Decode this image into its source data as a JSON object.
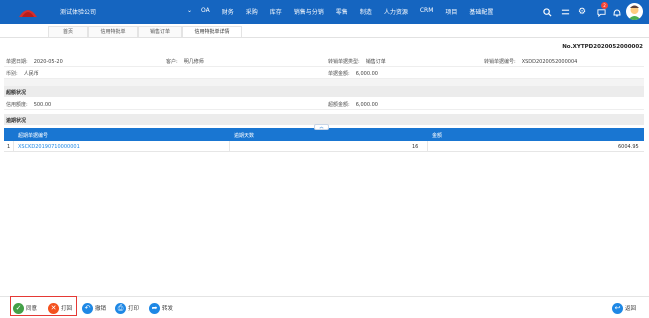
{
  "header": {
    "company": "测试体验公司",
    "nav": [
      "OA",
      "财务",
      "采购",
      "库存",
      "销售与分销",
      "零售",
      "制造",
      "人力资源",
      "CRM",
      "项目",
      "基础配置"
    ],
    "notification_count": "2"
  },
  "tabs": [
    "首页",
    "信用特批单",
    "销售订单",
    "信用特批单详情"
  ],
  "document": {
    "number": "No.XYTPD2020052000002",
    "date_label": "单据日期:",
    "date_value": "2020-05-20",
    "customer_label": "客户:",
    "customer_value": "明几修师",
    "transfer_type_label": "转销单据类型:",
    "transfer_type_value": "销售订单",
    "transfer_no_label": "转销单据编号:",
    "transfer_no_value": "XSDD2020052000004",
    "currency_label": "币别:",
    "currency_value": "人民币",
    "amount_label": "单据金额:",
    "amount_value": "6,000.00"
  },
  "sections": {
    "credit": "超额状况",
    "credit_limit_label": "信用额度:",
    "credit_limit_value": "500.00",
    "excess_label": "超额金额:",
    "excess_value": "6,000.00",
    "overdue": "逾期状况"
  },
  "table": {
    "headers": [
      "超期单据编号",
      "逾期天数",
      "金额"
    ],
    "rows": [
      {
        "index": "1",
        "doc": "XSCKD20190710000001",
        "days": "16",
        "amount": "6004.95"
      }
    ]
  },
  "actions": {
    "approve": "同意",
    "reject": "打回",
    "withdraw": "撤销",
    "print": "打印",
    "forward": "转发",
    "back": "返回"
  },
  "colors": {
    "primary": "#1565c0",
    "approve": "#43a047",
    "reject": "#f4511e",
    "neutral": "#1e88e5"
  }
}
